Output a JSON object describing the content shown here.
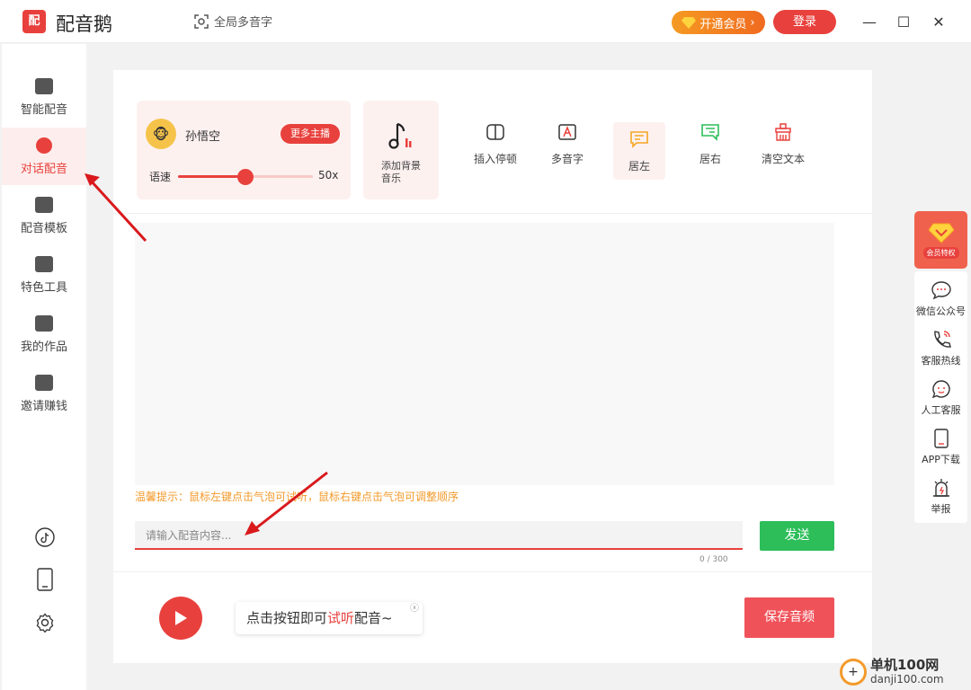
{
  "titlebar": {
    "logo_text": "配",
    "app_name": "配音鹅",
    "polyphonic_label": "全局多音字",
    "vip_label": "开通会员",
    "login_label": "登录",
    "minimize": "—",
    "maximize": "☐",
    "close": "✕"
  },
  "sidebar": {
    "items": [
      {
        "label": "智能配音",
        "icon": "speaker-icon"
      },
      {
        "label": "对话配音",
        "icon": "users-icon",
        "active": true
      },
      {
        "label": "配音模板",
        "icon": "template-icon"
      },
      {
        "label": "特色工具",
        "icon": "toolbox-icon"
      },
      {
        "label": "我的作品",
        "icon": "folder-icon"
      },
      {
        "label": "邀请赚钱",
        "icon": "money-bag-icon"
      }
    ]
  },
  "voice": {
    "name": "孙悟空",
    "more_anchor_label": "更多主播",
    "speed_label": "语速",
    "speed_value": "50x",
    "speed_level": 0.5
  },
  "bgm": {
    "label": "添加背景音乐"
  },
  "tools": [
    {
      "label": "插入停顿",
      "icon": "pause-icon"
    },
    {
      "label": "多音字",
      "icon": "polyphonic-icon"
    },
    {
      "label": "居左",
      "icon": "align-left-bubble-icon"
    },
    {
      "label": "居右",
      "icon": "align-right-bubble-icon"
    },
    {
      "label": "清空文本",
      "icon": "clear-icon"
    }
  ],
  "editor": {
    "tip": "温馨提示：鼠标左键点击气泡可试听，鼠标右键点击气泡可调整顺序",
    "placeholder": "请输入配音内容...",
    "send_label": "发送",
    "char_count": "0 / 300"
  },
  "player": {
    "bubble_prefix": "点击按钮即可",
    "bubble_highlight": "试听",
    "bubble_suffix": "配音~",
    "save_label": "保存音频"
  },
  "right_bar": {
    "vip_badge": "会员特权",
    "items": [
      {
        "label": "微信公众号",
        "icon": "wechat-icon"
      },
      {
        "label": "客服热线",
        "icon": "phone-icon"
      },
      {
        "label": "人工客服",
        "icon": "chat-icon"
      },
      {
        "label": "APP下载",
        "icon": "mobile-icon"
      },
      {
        "label": "举报",
        "icon": "alert-icon"
      }
    ]
  },
  "watermark": {
    "cn": "单机100网",
    "url": "danji100.com"
  },
  "colors": {
    "accent": "#e8413d",
    "send": "#2dbe5a",
    "tip": "#f39a2b",
    "vip_gradient_start": "#f59a23"
  }
}
